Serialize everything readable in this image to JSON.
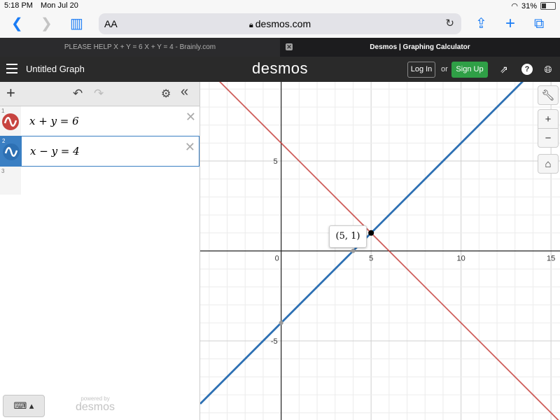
{
  "status_bar": {
    "time": "5:18 PM",
    "date": "Mon Jul 20",
    "battery": "31%",
    "battery_level": 0.31
  },
  "browser": {
    "text_size_label": "AA",
    "url_host": "desmos.com",
    "tabs": [
      {
        "title": "PLEASE HELP X + Y = 6 X + Y = 4 - Brainly.com",
        "active": false
      },
      {
        "title": "Desmos | Graphing Calculator",
        "active": true
      }
    ]
  },
  "header": {
    "graph_title": "Untitled Graph",
    "logo": "desmos",
    "login_label": "Log In",
    "or_label": "or",
    "signup_label": "Sign Up"
  },
  "expressions": [
    {
      "index": "1",
      "latex": "x + y = 6",
      "color": "#c74440",
      "selected": false
    },
    {
      "index": "2",
      "latex": "x − y = 4",
      "color": "#2d70b3",
      "selected": true
    }
  ],
  "empty_row_index": "3",
  "powered_by": {
    "small": "powered by",
    "brand": "desmos"
  },
  "graph": {
    "x_ticks": [
      "0",
      "5",
      "10",
      "15"
    ],
    "y_ticks": [
      "5",
      "-5"
    ],
    "intersection_label": "(5, 1)",
    "intersection": {
      "x": 5,
      "y": 1
    },
    "lines": [
      {
        "name": "x + y = 6",
        "slope": -1,
        "intercept": 6,
        "color": "#c74440"
      },
      {
        "name": "x − y = 4",
        "slope": 1,
        "intercept": -4,
        "color": "#2d70b3"
      }
    ],
    "x_range": [
      -4.5,
      15.5
    ],
    "y_range": [
      -9.4,
      9.4
    ]
  }
}
